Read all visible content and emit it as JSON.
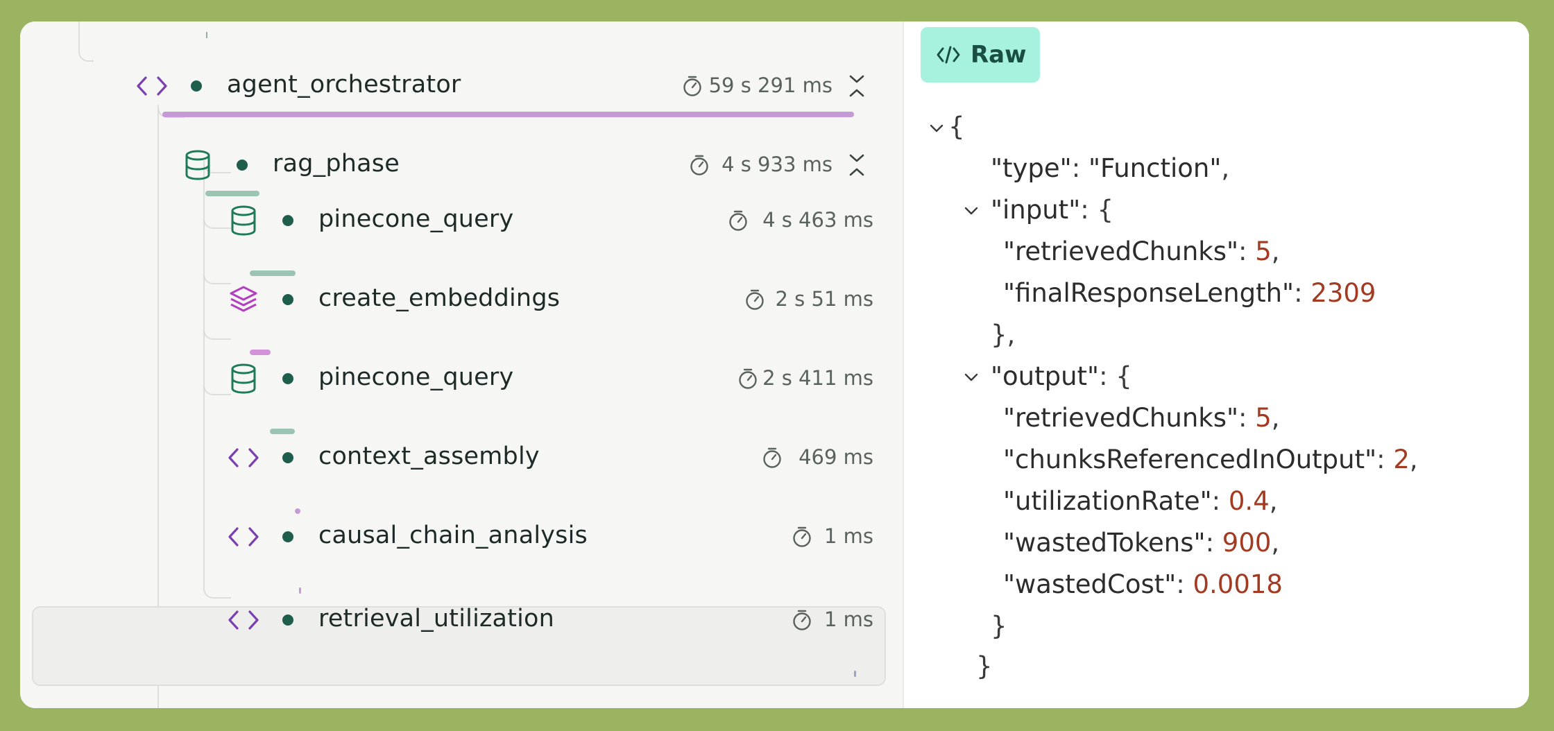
{
  "colors": {
    "background": "#9bb462",
    "code_icon": "#7b3fb0",
    "db_icon": "#1f7a58",
    "layers_icon": "#b23ec0",
    "dot": "#1f5e4c",
    "bar_purple": "#c49bd6",
    "bar_green": "#9cc4b2",
    "raw_button_bg": "#a6f2de",
    "number": "#a33a22"
  },
  "trace": {
    "spans": [
      {
        "name": "agent_orchestrator",
        "duration": "59 s 291 ms",
        "icon": "code-icon",
        "collapsible": true
      },
      {
        "name": "rag_phase",
        "duration": "4 s 933 ms",
        "icon": "database-icon",
        "collapsible": true
      },
      {
        "name": "pinecone_query",
        "duration": "4 s 463 ms",
        "icon": "database-icon",
        "collapsible": false
      },
      {
        "name": "create_embeddings",
        "duration": "2 s 51 ms",
        "icon": "layers-icon",
        "collapsible": false
      },
      {
        "name": "pinecone_query",
        "duration": "2 s 411 ms",
        "icon": "database-icon",
        "collapsible": false
      },
      {
        "name": "context_assembly",
        "duration": "469 ms",
        "icon": "code-icon",
        "collapsible": false
      },
      {
        "name": "causal_chain_analysis",
        "duration": "1 ms",
        "icon": "code-icon",
        "collapsible": false
      },
      {
        "name": "retrieval_utilization",
        "duration": "1 ms",
        "icon": "code-icon",
        "collapsible": false,
        "selected": true
      }
    ]
  },
  "panel": {
    "raw_label": "Raw"
  },
  "json_view": {
    "open_brace": "{",
    "type_key": "\"type\"",
    "type_value": "\"Function\"",
    "input_key": "\"input\"",
    "input": {
      "k1": "\"retrievedChunks\"",
      "v1": "5",
      "k2": "\"finalResponseLength\"",
      "v2": "2309"
    },
    "close_input": "},",
    "output_key": "\"output\"",
    "output": {
      "k1": "\"retrievedChunks\"",
      "v1": "5",
      "k2": "\"chunksReferencedInOutput\"",
      "v2": "2",
      "k3": "\"utilizationRate\"",
      "v3": "0.4",
      "k4": "\"wastedTokens\"",
      "v4": "900",
      "k5": "\"wastedCost\"",
      "v5": "0.0018"
    },
    "close_output": "}",
    "close_root": "}"
  }
}
